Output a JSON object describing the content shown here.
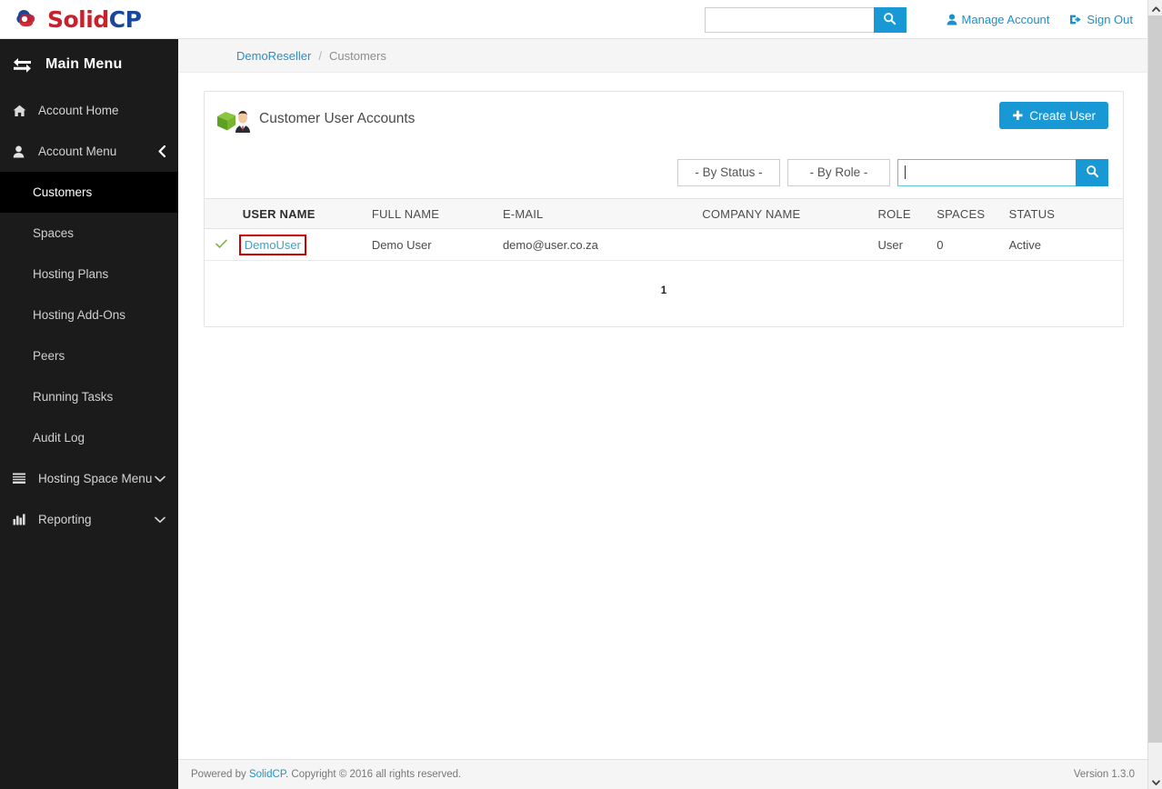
{
  "header": {
    "logo": {
      "icon": "solidcp-cloud-logo",
      "text_primary": "Solid",
      "text_secondary": "CP"
    },
    "search": {
      "value": "",
      "placeholder": "",
      "button_icon": "search-icon"
    },
    "manage_account": {
      "label": "Manage Account",
      "icon": "user-icon"
    },
    "sign_out": {
      "label": "Sign Out",
      "icon": "sign-out-icon"
    }
  },
  "sidebar": {
    "title": "Main Menu",
    "title_icon": "exchange-arrows-icon",
    "items": [
      {
        "label": "Account Home",
        "icon": "home-icon",
        "type": "item",
        "chevron": null
      },
      {
        "label": "Account Menu",
        "icon": "user-icon",
        "type": "item",
        "chevron": "chevron-left-icon"
      },
      {
        "label": "Customers",
        "type": "sub",
        "active": true
      },
      {
        "label": "Spaces",
        "type": "sub",
        "active": false
      },
      {
        "label": "Hosting Plans",
        "type": "sub",
        "active": false
      },
      {
        "label": "Hosting Add-Ons",
        "type": "sub",
        "active": false
      },
      {
        "label": "Peers",
        "type": "sub",
        "active": false
      },
      {
        "label": "Running Tasks",
        "type": "sub",
        "active": false
      },
      {
        "label": "Audit Log",
        "type": "sub",
        "active": false
      },
      {
        "label": "Hosting Space Menu",
        "icon": "list-icon",
        "type": "item",
        "chevron": "chevron-down-icon"
      },
      {
        "label": "Reporting",
        "icon": "bar-chart-icon",
        "type": "item",
        "chevron": "chevron-down-icon"
      }
    ]
  },
  "breadcrumb": {
    "root": "DemoReseller",
    "separator": "/",
    "current": "Customers"
  },
  "card": {
    "title": "Customer User Accounts",
    "title_icon": "green-box-businessman-icon",
    "create_button": {
      "label": "Create User",
      "icon": "plus-icon"
    }
  },
  "filters": {
    "status": {
      "label": "- By Status -",
      "options": [
        "- By Status -"
      ]
    },
    "role": {
      "label": "- By Role -",
      "options": [
        "- By Role -"
      ]
    },
    "search": {
      "value": "",
      "placeholder": "",
      "focused": true,
      "button_icon": "search-icon"
    }
  },
  "table": {
    "columns": [
      {
        "key": "check",
        "label": ""
      },
      {
        "key": "username",
        "label": "USER NAME",
        "bold": true
      },
      {
        "key": "fullname",
        "label": "FULL NAME",
        "bold": false
      },
      {
        "key": "email",
        "label": "E-MAIL",
        "bold": false
      },
      {
        "key": "company",
        "label": "COMPANY NAME",
        "bold": false
      },
      {
        "key": "role",
        "label": "ROLE",
        "bold": false
      },
      {
        "key": "spaces",
        "label": "SPACES",
        "bold": false
      },
      {
        "key": "status",
        "label": "STATUS",
        "bold": false
      }
    ],
    "rows": [
      {
        "check_icon": "check-mark-icon",
        "username": "DemoUser",
        "username_highlighted": true,
        "fullname": "Demo User",
        "email": "demo@user.co.za",
        "company": "",
        "role": "User",
        "spaces": "0",
        "status": "Active"
      }
    ],
    "pagination": {
      "current_page": "1"
    }
  },
  "footer": {
    "prefix": "Powered by ",
    "link": "SolidCP",
    "suffix": ". Copyright © 2016 all rights reserved.",
    "version": "Version 1.3.0"
  },
  "colors": {
    "accent": "#1899d6",
    "link": "#2d8fc1",
    "sidebar_bg": "#1b1b1b",
    "sidebar_active_bg": "#000000",
    "highlight_box": "#cc0000",
    "logo_red": "#c9202b",
    "logo_blue": "#18479c",
    "check_green": "#7cb342"
  },
  "scrollbar": {
    "up_icon": "chevron-up-icon",
    "down_icon": "chevron-down-icon"
  }
}
